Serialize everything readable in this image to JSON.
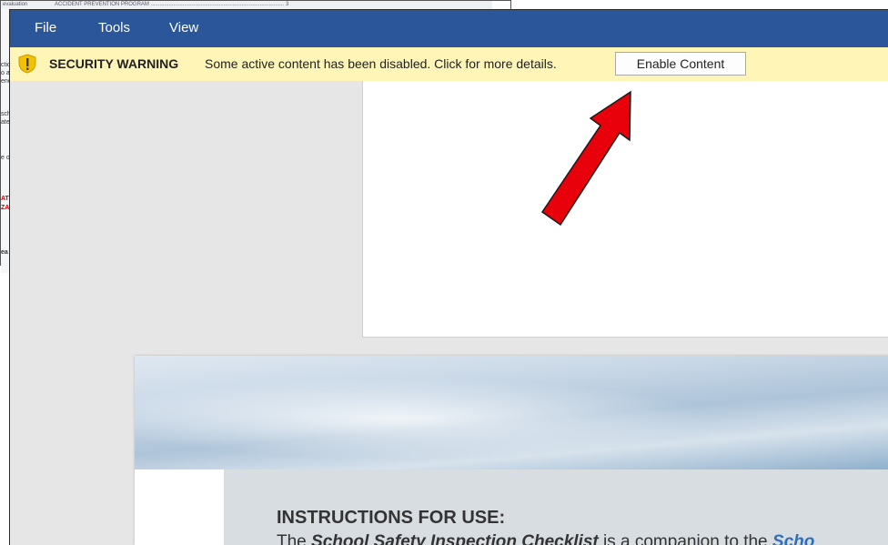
{
  "background_window": {
    "toc_text": "ACCIDENT PREVENTION PROGRAM ........................................................................................ 3",
    "left_fragments": [
      "evaluation",
      "ctio",
      "o a",
      "ene",
      "sch",
      "ate",
      "e o",
      "AT",
      "ZA",
      "ea"
    ]
  },
  "menu": {
    "items": [
      "File",
      "Tools",
      "View"
    ]
  },
  "security_bar": {
    "title": "SECURITY WARNING",
    "message": "Some active content has been disabled. Click for more details.",
    "button": "Enable Content"
  },
  "document": {
    "heading": "INSTRUCTIONS FOR USE:",
    "body_prefix": "The ",
    "body_emph": "School Safety Inspection Checklist",
    "body_middle": " is a companion to the ",
    "body_link": "Scho"
  },
  "colors": {
    "menubar": "#2b579a",
    "warning_bar": "#fff5b7",
    "arrow": "#e8000b"
  },
  "icons": {
    "warning": "shield-exclamation-icon",
    "annotation": "red-arrow-icon"
  }
}
